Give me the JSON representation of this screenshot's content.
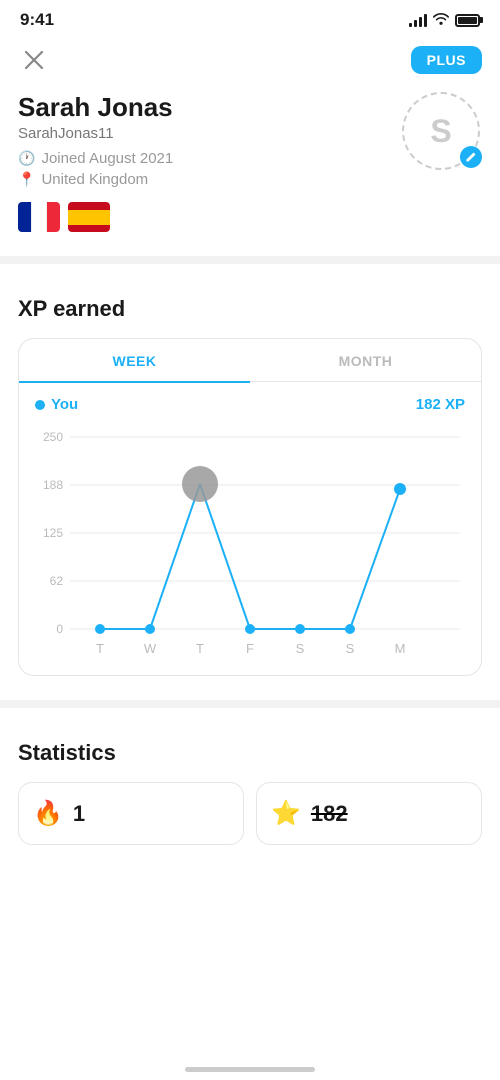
{
  "statusBar": {
    "time": "9:41",
    "battery": 90
  },
  "header": {
    "closeLabel": "×",
    "plusLabel": "PLUS"
  },
  "profile": {
    "name": "Sarah Jonas",
    "username": "SarahJonas11",
    "joined": "Joined August 2021",
    "location": "United Kingdom",
    "avatarLetter": "S"
  },
  "flags": [
    {
      "code": "fr",
      "label": "French flag"
    },
    {
      "code": "es",
      "label": "Spanish flag"
    }
  ],
  "xpSection": {
    "title": "XP earned",
    "tabs": [
      "WEEK",
      "MONTH"
    ],
    "activeTab": "WEEK",
    "legendLabel": "You",
    "xpValue": "182 XP",
    "chartLabels": [
      "T",
      "W",
      "T",
      "F",
      "S",
      "S",
      "M"
    ],
    "chartData": [
      0,
      0,
      188,
      0,
      0,
      0,
      182
    ],
    "yAxisLabels": [
      "250",
      "188",
      "125",
      "62",
      "0"
    ]
  },
  "statsSection": {
    "title": "Statistics",
    "cards": [
      {
        "icon": "🔥",
        "value": "1"
      },
      {
        "icon": "⭐",
        "value": "182"
      }
    ]
  }
}
